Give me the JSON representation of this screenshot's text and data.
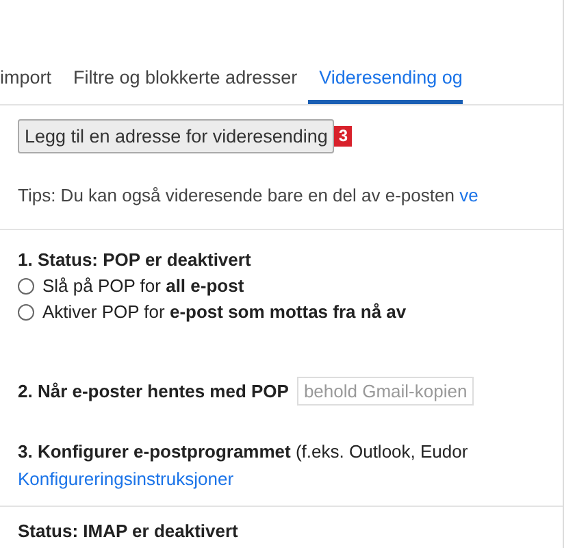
{
  "tabs": [
    {
      "label": "import",
      "selected": false
    },
    {
      "label": "Filtre og blokkerte adresser",
      "selected": false
    },
    {
      "label": "Videresending og",
      "selected": true
    }
  ],
  "forward_button": {
    "label": "Legg til en adresse for videresending"
  },
  "callout_badge": {
    "label": "3"
  },
  "tip": {
    "text": "Tips: Du kan også videresende bare en del av e-posten",
    "link": "ve"
  },
  "pop": {
    "status": "1. Status: POP er deaktivert",
    "options": [
      {
        "label": "Slå på POP for **all e-post**",
        "selected": false
      },
      {
        "label": "Aktiver POP for **e-post som mottas fra nå av**",
        "selected": false
      }
    ]
  },
  "when_fetched": {
    "label": "2. Når e-poster hentes med POP",
    "select_value": "behold Gmail-kopien"
  },
  "configure": {
    "text": "**3. Konfigurer e-postprogrammet** (f.eks. Outlook, Eudor",
    "link": "Konfigureringsinstruksjoner"
  },
  "imap": {
    "status": "Status: IMAP er deaktivert"
  }
}
